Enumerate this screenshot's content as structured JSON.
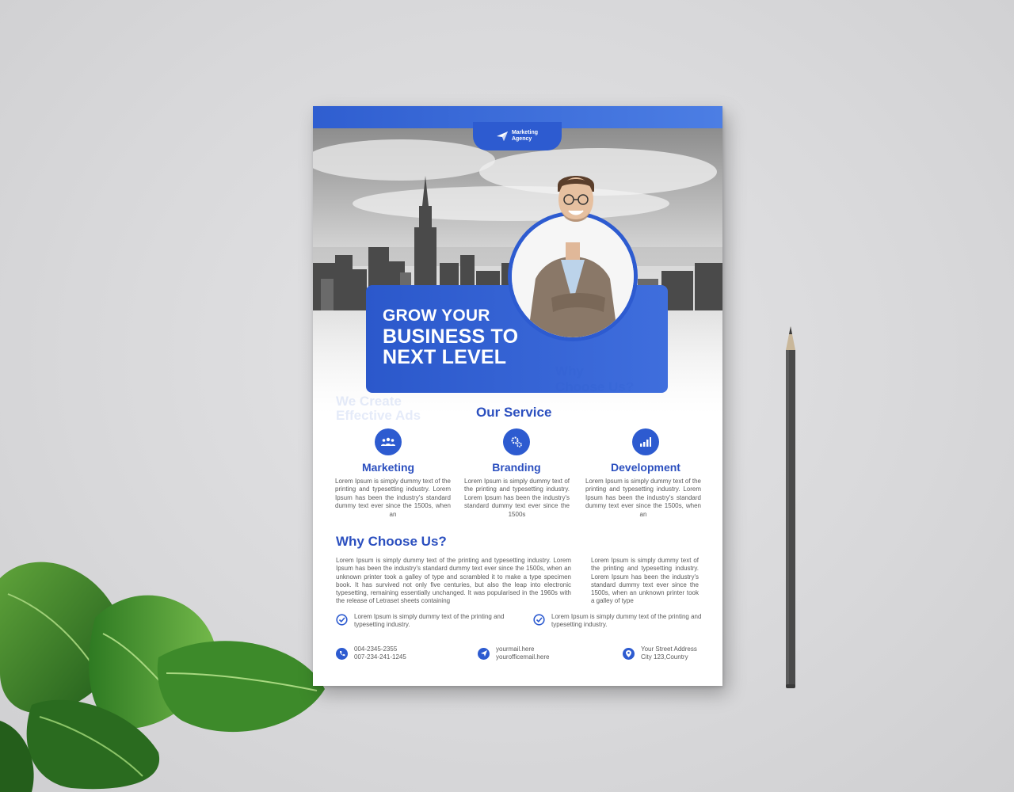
{
  "flyer": {
    "logo": {
      "line1": "Marketing",
      "line2": "Agency"
    },
    "headline": {
      "line1": "GROW YOUR",
      "line2": "BUSINESS TO",
      "line3": "NEXT LEVEL"
    },
    "ghost": {
      "why": "Why",
      "choose": "Choose Us?",
      "we_create": "We Create",
      "effective": "Effective Ads"
    },
    "services": {
      "title": "Our Service",
      "items": [
        {
          "name": "Marketing",
          "icon": "team-icon",
          "text": "Lorem Ipsum is simply dummy text of the printing and typesetting industry. Lorem Ipsum has been the industry's standard dummy text ever since the 1500s, when an"
        },
        {
          "name": "Branding",
          "icon": "gears-icon",
          "text": "Lorem Ipsum is simply dummy text of the printing and typesetting industry. Lorem Ipsum has been the industry's standard dummy text ever since the 1500s"
        },
        {
          "name": "Development",
          "icon": "bar-chart-icon",
          "text": "Lorem Ipsum is simply dummy text of the printing and typesetting industry. Lorem Ipsum has been the industry's standard dummy text ever since the 1500s, when an"
        }
      ]
    },
    "why": {
      "title": "Why Choose Us?",
      "main_text": "Lorem Ipsum is simply dummy text of the printing and typesetting industry. Lorem Ipsum has been the industry's standard dummy text ever since the 1500s, when an unknown printer took a galley of type and scrambled it to make a type specimen book. It has survived not only five centuries, but also the leap into electronic typesetting, remaining essentially unchanged. It was popularised in the 1960s with the release of Letraset sheets containing",
      "side_text": "Lorem Ipsum is simply dummy text of the printing and typesetting industry. Lorem Ipsum has been the industry's standard dummy text ever since the 1500s, when an unknown printer took a galley of type",
      "checks": [
        "Lorem Ipsum is simply dummy text of the printing and typesetting industry.",
        "Lorem Ipsum is simply dummy text of the printing and typesetting industry."
      ]
    },
    "contact": {
      "phone1": "004-2345-2355",
      "phone2": "007-234-241-1245",
      "email1": "yourmail.here",
      "email2": "yourofficemail.here",
      "address1": "Your Street Address",
      "address2": "City 123,Country"
    }
  },
  "colors": {
    "brand_blue": "#2d5bd0",
    "heading_blue": "#2b4fbf",
    "background": "#dcdcde"
  }
}
